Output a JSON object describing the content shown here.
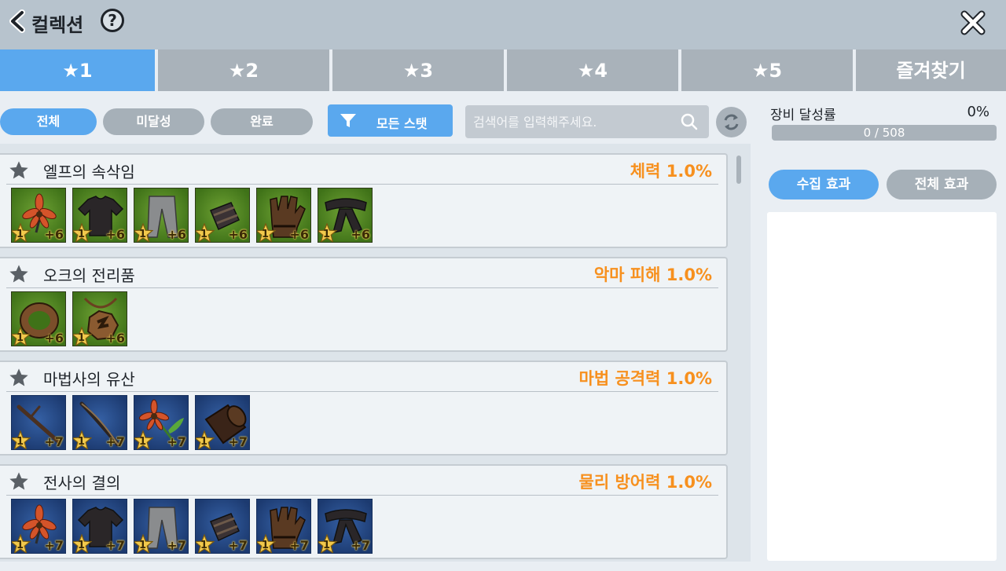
{
  "header": {
    "title": "컬렉션",
    "help_icon": "?"
  },
  "tabs": [
    {
      "label": "★1",
      "active": true
    },
    {
      "label": "★2",
      "active": false
    },
    {
      "label": "★3",
      "active": false
    },
    {
      "label": "★4",
      "active": false
    },
    {
      "label": "★5",
      "active": false
    },
    {
      "label": "즐겨찾기",
      "active": false
    }
  ],
  "filters": {
    "all": "전체",
    "incomplete": "미달성",
    "complete": "완료",
    "stat_filter": "모든 스탯",
    "search_placeholder": "검색어를 입력해주세요."
  },
  "collections": [
    {
      "name": "엘프의 속삭임",
      "bonus": "체력 1.0%",
      "frame": "green",
      "items": [
        {
          "icon": "flower-icon",
          "level": "1",
          "plus": "+6"
        },
        {
          "icon": "shirt-icon",
          "level": "1",
          "plus": "+6"
        },
        {
          "icon": "pants-icon",
          "level": "1",
          "plus": "+6"
        },
        {
          "icon": "bracer-icon",
          "level": "1",
          "plus": "+6"
        },
        {
          "icon": "glove-icon",
          "level": "1",
          "plus": "+6"
        },
        {
          "icon": "scarf-icon",
          "level": "1",
          "plus": "+6"
        }
      ]
    },
    {
      "name": "오크의 전리품",
      "bonus": "악마 피해 1.0%",
      "frame": "green",
      "items": [
        {
          "icon": "ring-icon",
          "level": "1",
          "plus": "+6"
        },
        {
          "icon": "amulet-icon",
          "level": "1",
          "plus": "+6"
        }
      ]
    },
    {
      "name": "마법사의 유산",
      "bonus": "마법 공격력 1.0%",
      "frame": "blue",
      "items": [
        {
          "icon": "wand-icon",
          "level": "1",
          "plus": "+7"
        },
        {
          "icon": "staff-icon",
          "level": "1",
          "plus": "+7"
        },
        {
          "icon": "flower-wand-icon",
          "level": "1",
          "plus": "+7"
        },
        {
          "icon": "log-icon",
          "level": "1",
          "plus": "+7"
        }
      ]
    },
    {
      "name": "전사의 결의",
      "bonus": "물리 방어력 1.0%",
      "frame": "blue",
      "items": [
        {
          "icon": "flower-icon",
          "level": "1",
          "plus": "+7"
        },
        {
          "icon": "shirt-icon",
          "level": "1",
          "plus": "+7"
        },
        {
          "icon": "pants-icon",
          "level": "1",
          "plus": "+7"
        },
        {
          "icon": "bracer-icon",
          "level": "1",
          "plus": "+7"
        },
        {
          "icon": "glove-icon",
          "level": "1",
          "plus": "+7"
        },
        {
          "icon": "scarf-icon",
          "level": "1",
          "plus": "+7"
        }
      ]
    }
  ],
  "achievement": {
    "label": "장비 달성률",
    "percent": "0%",
    "progress_text": "0 / 508",
    "progress_fraction": 0
  },
  "effects": {
    "collect_label": "수집 효과",
    "total_label": "전체 효과"
  },
  "colors": {
    "accent": "#5aa8ee",
    "bonus": "#f7901e",
    "header": "#b7c3cd"
  }
}
